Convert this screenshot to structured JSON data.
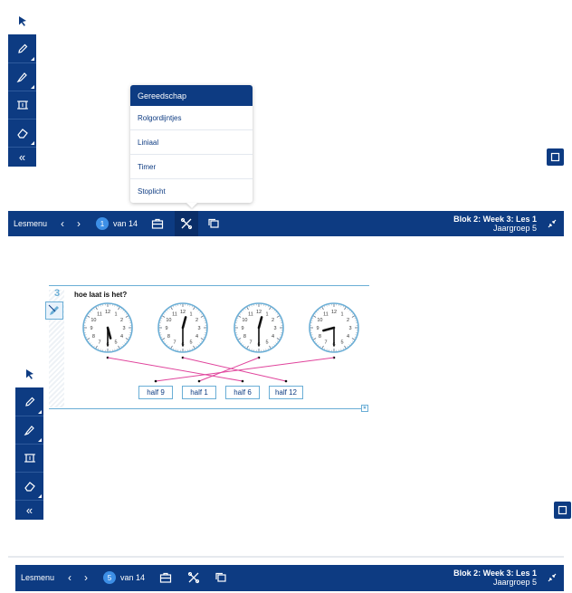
{
  "colors": {
    "navy": "#0d3b82",
    "accent": "#3d8fe6",
    "line_pink": "#e0449c",
    "rule_blue": "#6aaed6"
  },
  "menu": {
    "title": "Gereedschap",
    "items": [
      "Rolgordijntjes",
      "Liniaal",
      "Timer",
      "Stoplicht"
    ]
  },
  "top_nav": {
    "lesmenu": "Lesmenu",
    "page_number": "1",
    "page_of": "van 14",
    "blok": "Blok 2: Week 3: Les 1",
    "jaargroep": "Jaargroep 5"
  },
  "bottom_nav": {
    "lesmenu": "Lesmenu",
    "page_number": "5",
    "page_of": "van 14",
    "blok": "Blok 2: Week 3: Les 1",
    "jaargroep": "Jaargroep 5"
  },
  "exercise": {
    "number": "3",
    "question": "hoe laat is het?",
    "answers": [
      "half 9",
      "half 1",
      "half 6",
      "half 12"
    ],
    "clock_numbers": [
      "12",
      "1",
      "2",
      "3",
      "4",
      "5",
      "6",
      "7",
      "8",
      "9",
      "10",
      "11"
    ]
  },
  "icons": {
    "pointer": "pointer-icon",
    "pencil": "pencil-icon",
    "marker": "marker-icon",
    "frame": "frame-icon",
    "eraser": "eraser-icon",
    "collapse": "collapse-icon",
    "toolbox": "toolbox-icon",
    "tools": "tools-icon",
    "windows": "windows-icon",
    "exit_fullscreen": "exit-fullscreen-icon"
  }
}
